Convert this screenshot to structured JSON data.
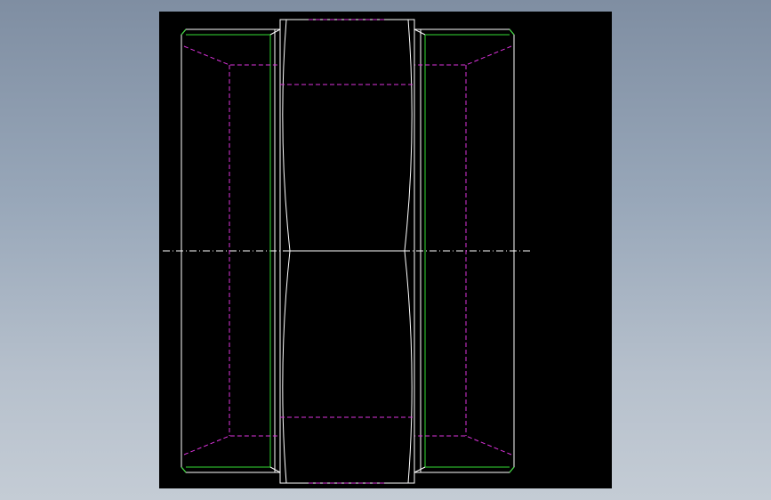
{
  "view": {
    "background_gradient": [
      "#7f8ea2",
      "#c4ccd5"
    ],
    "sheet_color": "#000000"
  },
  "colors": {
    "visible_edge": "#ffffff",
    "thread_line": "#33dd33",
    "hidden_line": "#dd33dd",
    "center_line": "#ffffff"
  },
  "line_styles": {
    "hidden_line": "dashed",
    "center_line": "dash-dot"
  }
}
